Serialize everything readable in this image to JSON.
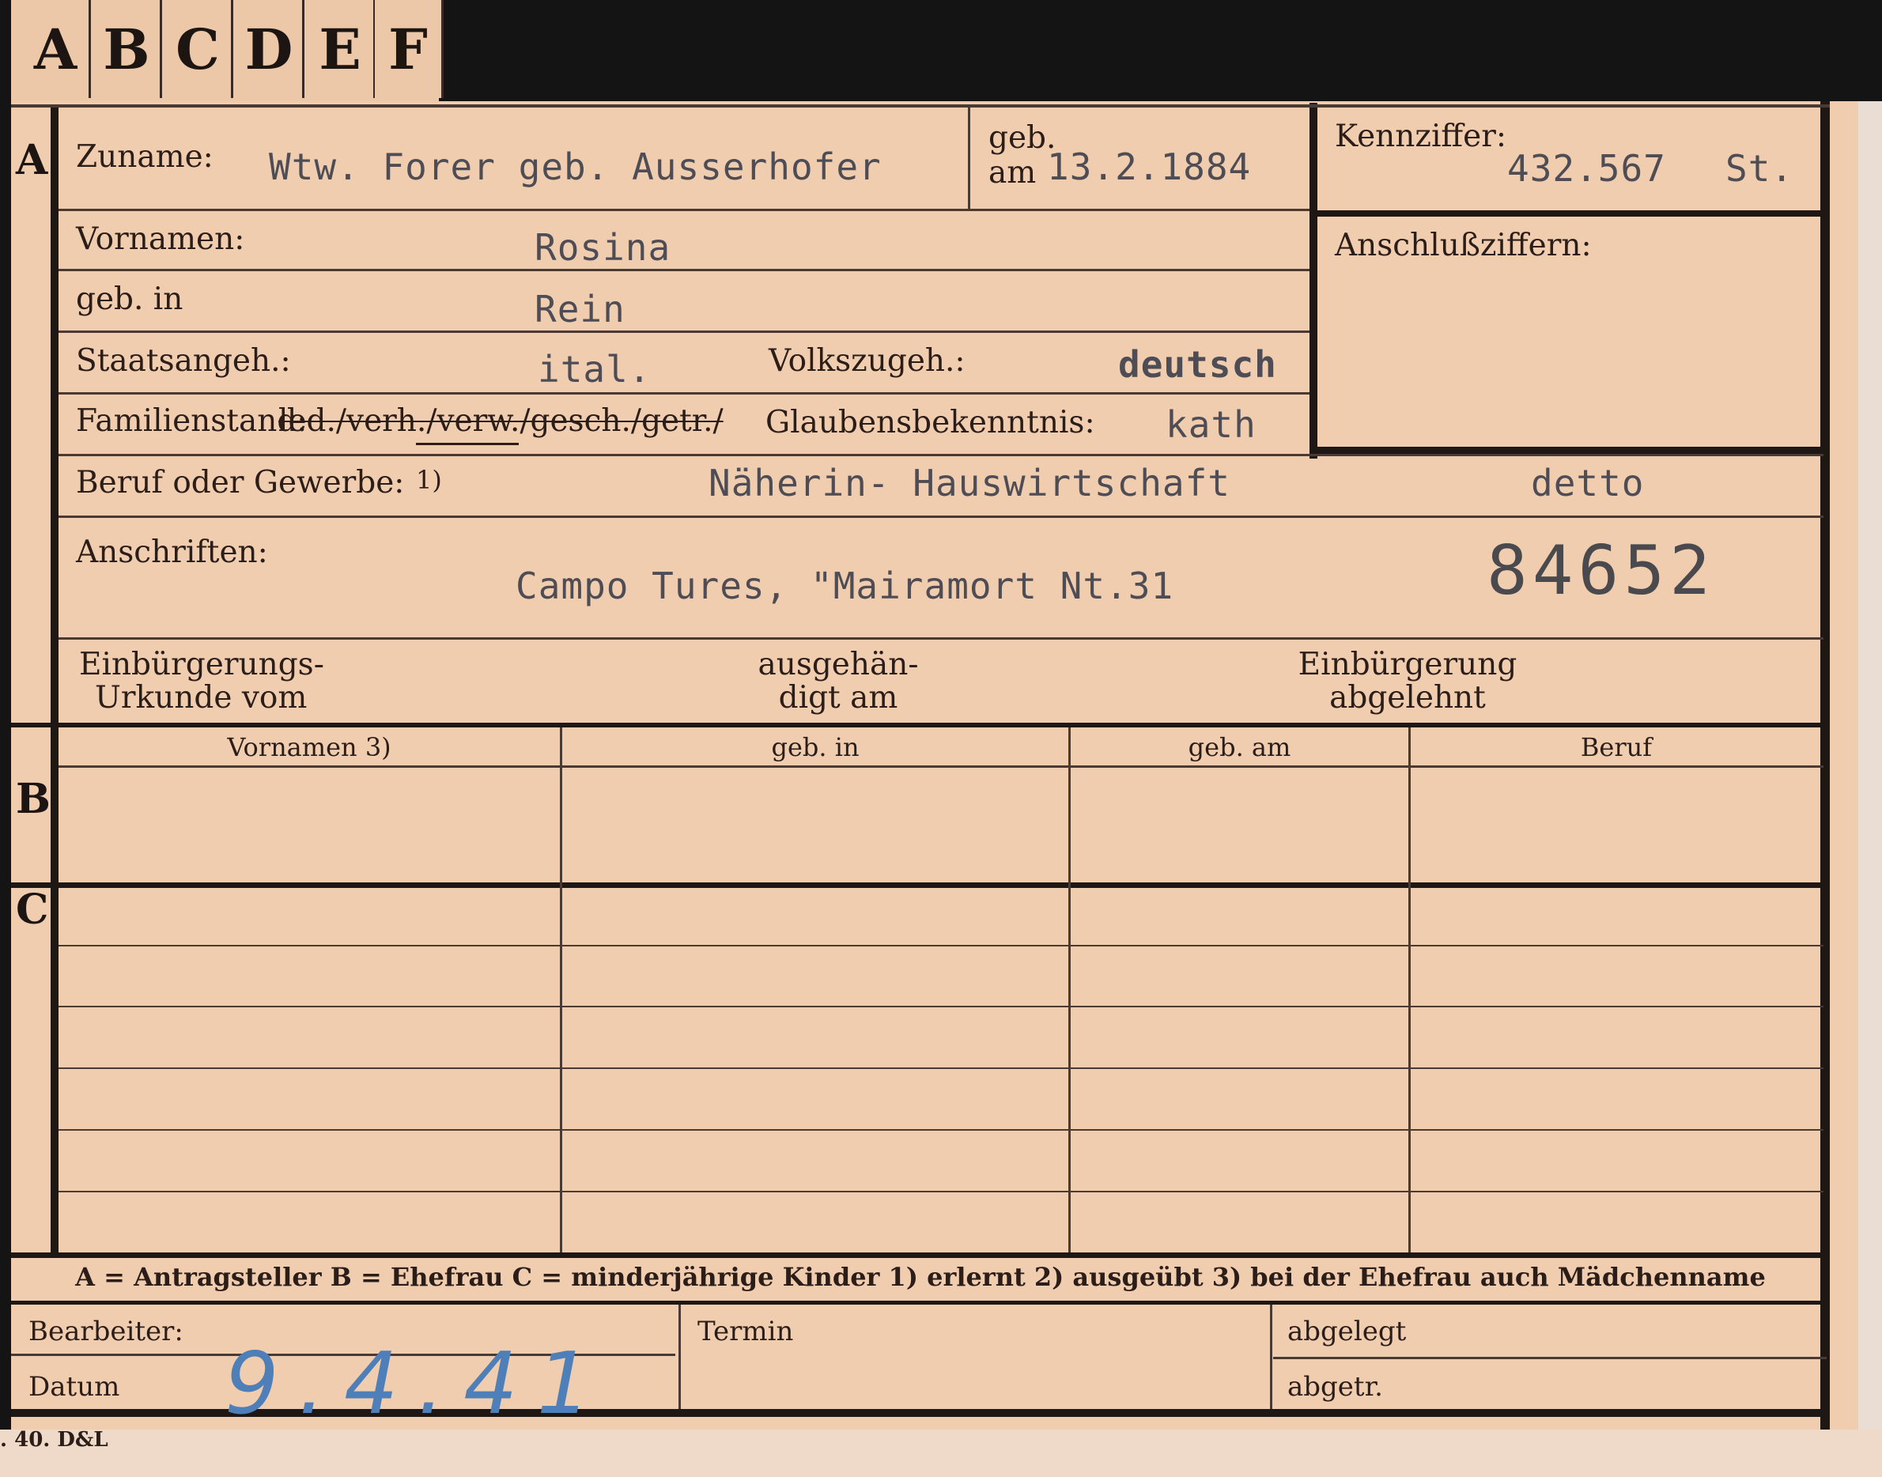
{
  "tabs": [
    "A",
    "B",
    "C",
    "D",
    "E",
    "F"
  ],
  "sections": {
    "a": "A",
    "b": "B",
    "c": "C"
  },
  "labels": {
    "zuname": "Zuname:",
    "geb": "geb.",
    "am": "am",
    "kennziffer": "Kennziffer:",
    "anschlussziffern": "Anschlußziffern:",
    "vornamen": "Vornamen:",
    "geb_in": "geb. in",
    "staatsangeh": "Staatsangeh.:",
    "volkszugeh": "Volkszugeh.:",
    "familienstand": "Familienstand:",
    "familienstand_options": "led./verh./verw./gesch./getr./",
    "glaubensbekenntnis": "Glaubensbekenntnis:",
    "beruf": "Beruf oder Gewerbe:",
    "beruf_note": "1)",
    "anschriften": "Anschriften:",
    "einb_urkunde_1": "Einbürgerungs-",
    "einb_urkunde_2": "Urkunde vom",
    "ausgehaendigt_1": "ausgehän-",
    "ausgehaendigt_2": "digt am",
    "einb_abgelehnt_1": "Einbürgerung",
    "einb_abgelehnt_2": "abgelehnt",
    "bearbeiter": "Bearbeiter:",
    "datum": "Datum",
    "termin": "Termin",
    "abgelegt": "abgelegt",
    "abgetr": "abgetr."
  },
  "table_headers": [
    "Vornamen 3)",
    "geb. in",
    "geb. am",
    "Beruf"
  ],
  "legend": "A = Antragsteller   B = Ehefrau   C = minderjährige Kinder   1) erlernt   2) ausgeübt   3) bei der Ehefrau auch Mädchenname",
  "values": {
    "zuname": "Wtw. Forer  geb. Ausserhofer",
    "geburtsdatum": "13.2.1884",
    "kennziffer": "432.567",
    "kennziffer_suffix": "St.",
    "vornamen": "Rosina",
    "geb_in": "Rein",
    "staatsangeh": "ital.",
    "volkszugeh": "deutsch",
    "glaubensbekenntnis": "kath",
    "beruf": "Näherin- Hauswirtschaft",
    "beruf_2": "detto",
    "anschrift": "Campo Tures, \"Mairamort  Nt.31",
    "stamp_number": "84652",
    "datum": "9.4.41"
  },
  "footer_print": ". 40. D&L",
  "colors": {
    "card": "#f1cdb0",
    "frame": "#141414",
    "ink_type": "#4e4d55",
    "ink_pencil": "#4f7fb8"
  }
}
